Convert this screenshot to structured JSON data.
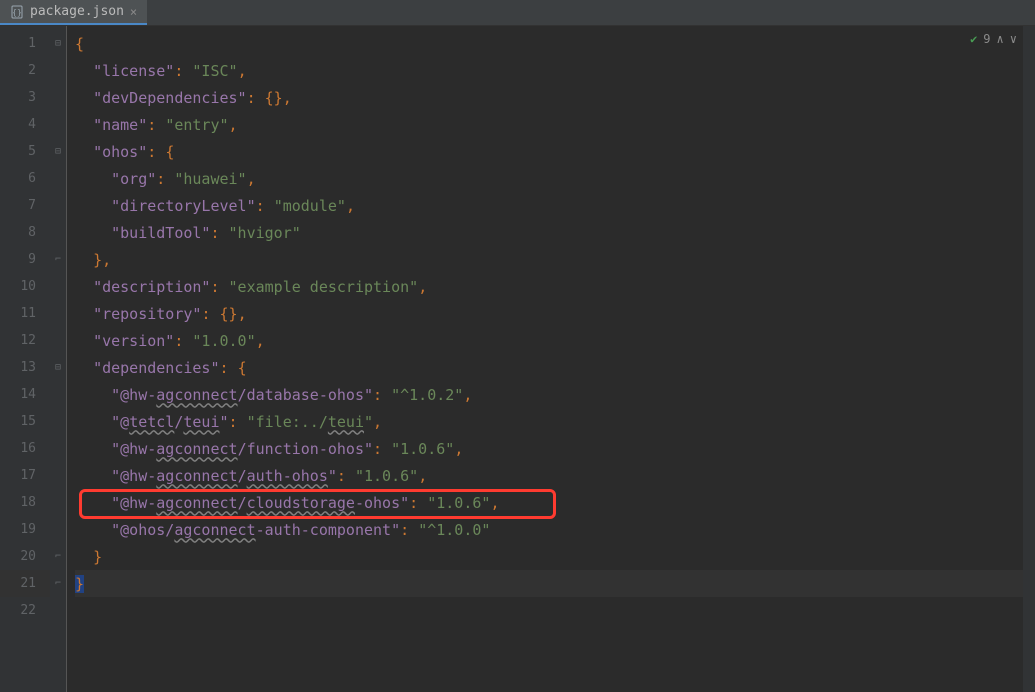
{
  "tab": {
    "label": "package.json"
  },
  "status": {
    "count": "9"
  },
  "lines": [
    {
      "num": "1",
      "fold": "open",
      "indent": "",
      "parts": [
        {
          "t": "brace",
          "v": "{"
        }
      ]
    },
    {
      "num": "2",
      "indent": "  ",
      "parts": [
        {
          "t": "key",
          "v": "\"license\""
        },
        {
          "t": "colon",
          "v": ": "
        },
        {
          "t": "string",
          "v": "\"ISC\""
        },
        {
          "t": "comma",
          "v": ","
        }
      ]
    },
    {
      "num": "3",
      "indent": "  ",
      "parts": [
        {
          "t": "key",
          "v": "\"devDependencies\""
        },
        {
          "t": "colon",
          "v": ": "
        },
        {
          "t": "brace",
          "v": "{}"
        },
        {
          "t": "comma",
          "v": ","
        }
      ]
    },
    {
      "num": "4",
      "indent": "  ",
      "parts": [
        {
          "t": "key",
          "v": "\"name\""
        },
        {
          "t": "colon",
          "v": ": "
        },
        {
          "t": "string",
          "v": "\"entry\""
        },
        {
          "t": "comma",
          "v": ","
        }
      ]
    },
    {
      "num": "5",
      "fold": "open",
      "indent": "  ",
      "parts": [
        {
          "t": "key",
          "v": "\"ohos\""
        },
        {
          "t": "colon",
          "v": ": "
        },
        {
          "t": "brace",
          "v": "{"
        }
      ]
    },
    {
      "num": "6",
      "indent": "    ",
      "parts": [
        {
          "t": "key",
          "v": "\"org\""
        },
        {
          "t": "colon",
          "v": ": "
        },
        {
          "t": "string",
          "v": "\"huawei\""
        },
        {
          "t": "comma",
          "v": ","
        }
      ]
    },
    {
      "num": "7",
      "indent": "    ",
      "parts": [
        {
          "t": "key",
          "v": "\"directoryLevel\""
        },
        {
          "t": "colon",
          "v": ": "
        },
        {
          "t": "string",
          "v": "\"module\""
        },
        {
          "t": "comma",
          "v": ","
        }
      ]
    },
    {
      "num": "8",
      "indent": "    ",
      "parts": [
        {
          "t": "key",
          "v": "\"buildTool\""
        },
        {
          "t": "colon",
          "v": ": "
        },
        {
          "t": "string",
          "v": "\"hvigor\""
        }
      ]
    },
    {
      "num": "9",
      "fold": "close",
      "indent": "  ",
      "parts": [
        {
          "t": "brace",
          "v": "}"
        },
        {
          "t": "comma",
          "v": ","
        }
      ]
    },
    {
      "num": "10",
      "indent": "  ",
      "parts": [
        {
          "t": "key",
          "v": "\"description\""
        },
        {
          "t": "colon",
          "v": ": "
        },
        {
          "t": "string",
          "v": "\"example description\""
        },
        {
          "t": "comma",
          "v": ","
        }
      ]
    },
    {
      "num": "11",
      "indent": "  ",
      "parts": [
        {
          "t": "key",
          "v": "\"repository\""
        },
        {
          "t": "colon",
          "v": ": "
        },
        {
          "t": "brace",
          "v": "{}"
        },
        {
          "t": "comma",
          "v": ","
        }
      ]
    },
    {
      "num": "12",
      "indent": "  ",
      "parts": [
        {
          "t": "key",
          "v": "\"version\""
        },
        {
          "t": "colon",
          "v": ": "
        },
        {
          "t": "string",
          "v": "\"1.0.0\""
        },
        {
          "t": "comma",
          "v": ","
        }
      ]
    },
    {
      "num": "13",
      "fold": "open",
      "indent": "  ",
      "parts": [
        {
          "t": "key",
          "v": "\"dependencies\""
        },
        {
          "t": "colon",
          "v": ": "
        },
        {
          "t": "brace",
          "v": "{"
        }
      ]
    },
    {
      "num": "14",
      "indent": "    ",
      "parts": [
        {
          "t": "key",
          "v": "\"@hw-"
        },
        {
          "t": "key underline",
          "v": "agconnect"
        },
        {
          "t": "key",
          "v": "/database-ohos\""
        },
        {
          "t": "colon",
          "v": ": "
        },
        {
          "t": "string",
          "v": "\"^1.0.2\""
        },
        {
          "t": "comma",
          "v": ","
        }
      ]
    },
    {
      "num": "15",
      "indent": "    ",
      "parts": [
        {
          "t": "key",
          "v": "\"@"
        },
        {
          "t": "key underline",
          "v": "tetcl"
        },
        {
          "t": "key",
          "v": "/"
        },
        {
          "t": "key underline",
          "v": "teui"
        },
        {
          "t": "key",
          "v": "\""
        },
        {
          "t": "colon",
          "v": ": "
        },
        {
          "t": "string",
          "v": "\"file:../"
        },
        {
          "t": "string underline",
          "v": "teui"
        },
        {
          "t": "string",
          "v": "\""
        },
        {
          "t": "comma",
          "v": ","
        }
      ]
    },
    {
      "num": "16",
      "indent": "    ",
      "parts": [
        {
          "t": "key",
          "v": "\"@hw-"
        },
        {
          "t": "key underline",
          "v": "agconnect"
        },
        {
          "t": "key",
          "v": "/function-ohos\""
        },
        {
          "t": "colon",
          "v": ": "
        },
        {
          "t": "string",
          "v": "\"1.0.6\""
        },
        {
          "t": "comma",
          "v": ","
        }
      ]
    },
    {
      "num": "17",
      "indent": "    ",
      "parts": [
        {
          "t": "key",
          "v": "\"@hw-"
        },
        {
          "t": "key underline",
          "v": "agconnect"
        },
        {
          "t": "key",
          "v": "/"
        },
        {
          "t": "key underline",
          "v": "auth-ohos"
        },
        {
          "t": "key",
          "v": "\""
        },
        {
          "t": "colon",
          "v": ": "
        },
        {
          "t": "string",
          "v": "\"1.0.6\""
        },
        {
          "t": "comma",
          "v": ","
        }
      ]
    },
    {
      "num": "18",
      "indent": "    ",
      "parts": [
        {
          "t": "key",
          "v": "\"@hw-"
        },
        {
          "t": "key underline",
          "v": "agconnect"
        },
        {
          "t": "key",
          "v": "/"
        },
        {
          "t": "key underline",
          "v": "cloudstorage"
        },
        {
          "t": "key",
          "v": "-ohos\""
        },
        {
          "t": "colon",
          "v": ": "
        },
        {
          "t": "string",
          "v": "\"1.0.6\""
        },
        {
          "t": "comma",
          "v": ","
        }
      ]
    },
    {
      "num": "19",
      "indent": "    ",
      "parts": [
        {
          "t": "key",
          "v": "\"@ohos/"
        },
        {
          "t": "key underline",
          "v": "agconnect"
        },
        {
          "t": "key",
          "v": "-auth-component\""
        },
        {
          "t": "colon",
          "v": ": "
        },
        {
          "t": "string",
          "v": "\"^1.0.0\""
        }
      ]
    },
    {
      "num": "20",
      "fold": "close",
      "indent": "  ",
      "parts": [
        {
          "t": "brace",
          "v": "}"
        }
      ]
    },
    {
      "num": "21",
      "fold": "close",
      "indent": "",
      "parts": [
        {
          "t": "brace selection",
          "v": "}"
        }
      ],
      "current": true
    },
    {
      "num": "22",
      "indent": "",
      "parts": []
    }
  ]
}
